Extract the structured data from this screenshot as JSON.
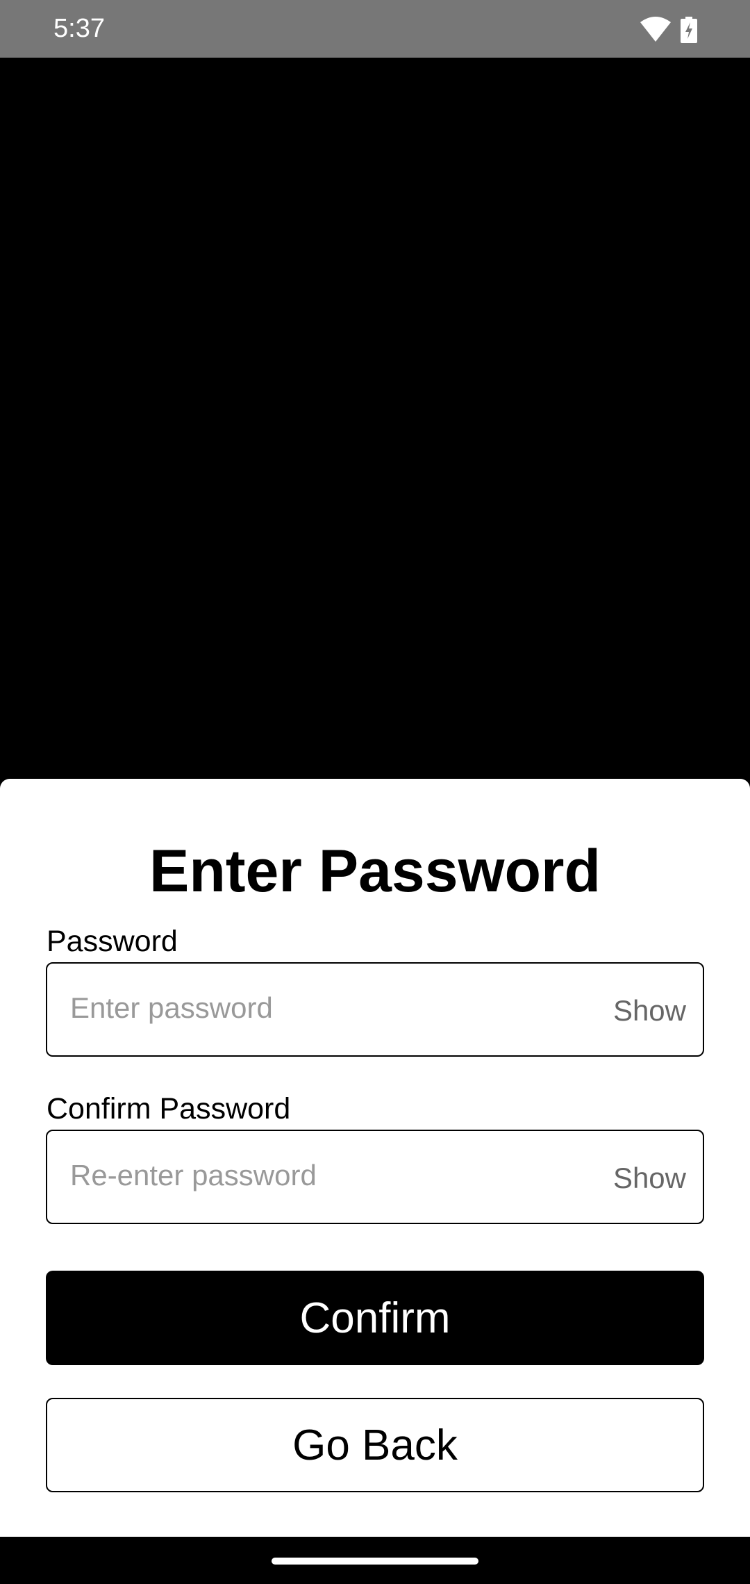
{
  "status_bar": {
    "time": "5:37",
    "icons": [
      "wifi-icon",
      "battery-charging-icon"
    ]
  },
  "dialog": {
    "title": "Enter Password",
    "password": {
      "label": "Password",
      "placeholder": "Enter password",
      "toggle": "Show"
    },
    "confirm_password": {
      "label": "Confirm Password",
      "placeholder": "Re-enter password",
      "toggle": "Show"
    },
    "confirm_button": "Confirm",
    "back_button": "Go Back"
  },
  "colors": {
    "status_bar": "#777777",
    "primary": "#000000",
    "placeholder": "#999999"
  }
}
